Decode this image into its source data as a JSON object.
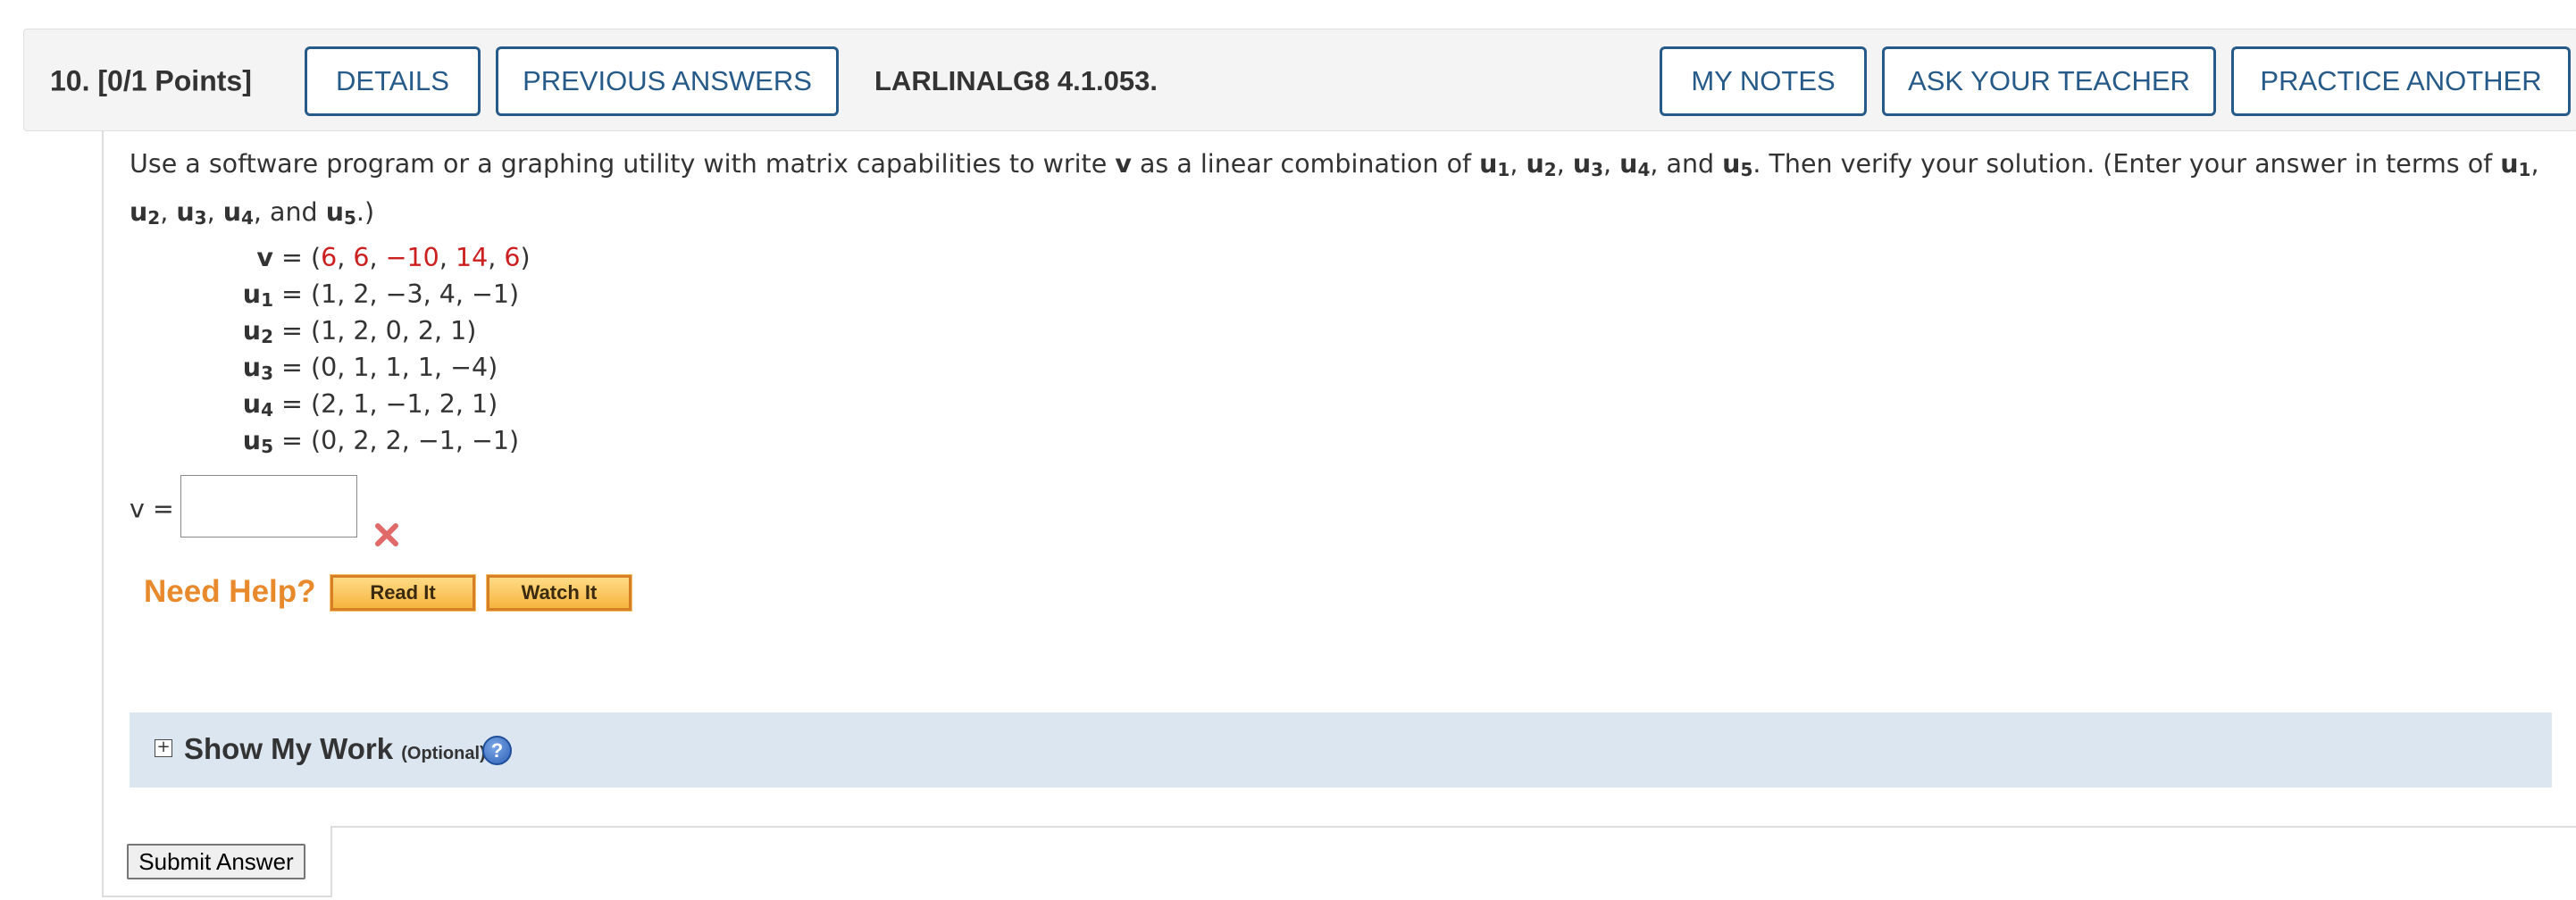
{
  "header": {
    "question_label": "10.  [0/1 Points]",
    "details_label": "DETAILS",
    "previous_answers_label": "PREVIOUS ANSWERS",
    "problem_code": "LARLINALG8 4.1.053.",
    "my_notes_label": "MY NOTES",
    "ask_teacher_label": "ASK YOUR TEACHER",
    "practice_another_label": "PRACTICE ANOTHER"
  },
  "prompt": {
    "t1": "Use a software program or a graphing utility with matrix capabilities to write ",
    "v": "v",
    "t2": " as a linear combination of ",
    "u": "u",
    "s1": "1",
    "s2": "2",
    "s3": "3",
    "s4": "4",
    "s5": "5",
    "comma": ", ",
    "and": ", and ",
    "t3": ". Then verify your solution. (Enter your answer in terms of ",
    "t4": ".)"
  },
  "vectors": {
    "v": {
      "label": "v",
      "open": "(",
      "c1": "6",
      "c2": "6",
      "c3": "−10",
      "c4": "14",
      "c5": "6",
      "close": ")"
    },
    "u1": {
      "label": "u",
      "sub": "1",
      "value": "(1, 2, −3, 4, −1)"
    },
    "u2": {
      "label": "u",
      "sub": "2",
      "value": "(1, 2, 0, 2, 1)"
    },
    "u3": {
      "label": "u",
      "sub": "3",
      "value": "(0, 1, 1, 1, −4)"
    },
    "u4": {
      "label": "u",
      "sub": "4",
      "value": "(2, 1, −1, 2, 1)"
    },
    "u5": {
      "label": "u",
      "sub": "5",
      "value": "(0, 2, 2, −1, −1)"
    },
    "eq": "=",
    "sep": ", "
  },
  "answer": {
    "label": "v =",
    "value": "",
    "status": "incorrect",
    "status_color": "#e06a6a"
  },
  "help": {
    "label": "Need Help?",
    "read_it": "Read It",
    "watch_it": "Watch It"
  },
  "show_work": {
    "title": "Show My Work",
    "optional": "(Optional)",
    "help_glyph": "?"
  },
  "submit_label": "Submit Answer",
  "colors": {
    "button_border": "#265a88",
    "highlight_red": "#cc1f1f",
    "help_orange": "#e8892b",
    "show_work_bg": "#dce6f0"
  }
}
